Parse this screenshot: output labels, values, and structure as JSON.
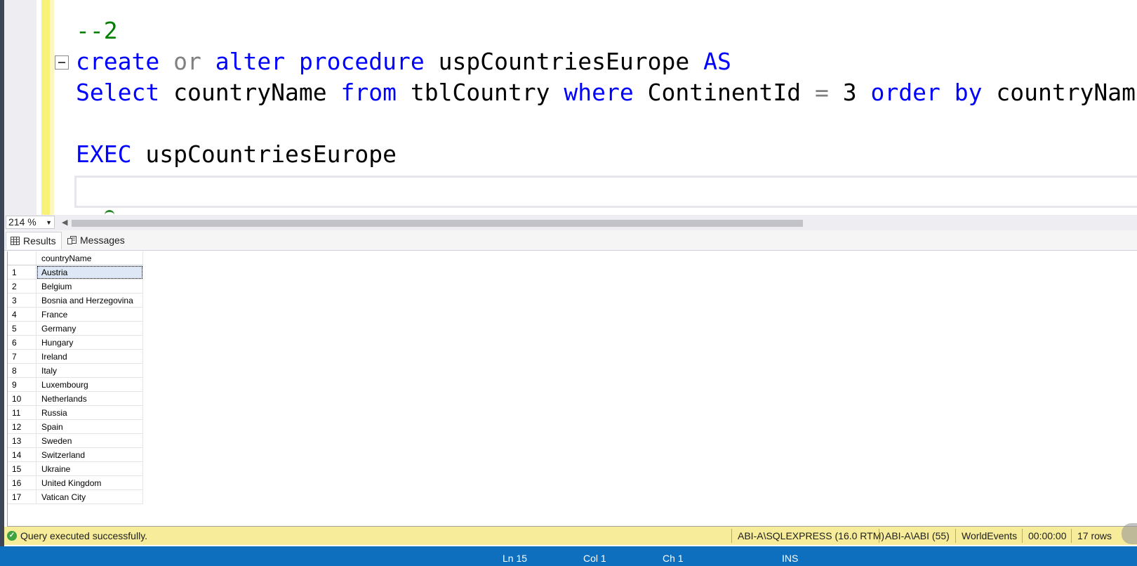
{
  "editor": {
    "lines": [
      {
        "tokens": [
          {
            "t": "--2",
            "c": "cmt"
          }
        ]
      },
      {
        "tokens": [
          {
            "t": "create",
            "c": "kw"
          },
          {
            "t": " ",
            "c": "id"
          },
          {
            "t": "or",
            "c": "gray"
          },
          {
            "t": " ",
            "c": "id"
          },
          {
            "t": "alter",
            "c": "kw"
          },
          {
            "t": " ",
            "c": "id"
          },
          {
            "t": "procedure",
            "c": "kw"
          },
          {
            "t": " uspCountriesEurope ",
            "c": "id"
          },
          {
            "t": "AS",
            "c": "kw"
          }
        ]
      },
      {
        "tokens": [
          {
            "t": "Select",
            "c": "kw"
          },
          {
            "t": " countryName ",
            "c": "id"
          },
          {
            "t": "from",
            "c": "kw"
          },
          {
            "t": " tblCountry ",
            "c": "id"
          },
          {
            "t": "where",
            "c": "kw"
          },
          {
            "t": " ContinentId ",
            "c": "id"
          },
          {
            "t": "=",
            "c": "gray"
          },
          {
            "t": " 3 ",
            "c": "id"
          },
          {
            "t": "order",
            "c": "kw"
          },
          {
            "t": " ",
            "c": "id"
          },
          {
            "t": "by",
            "c": "kw"
          },
          {
            "t": " countryName",
            "c": "id"
          }
        ]
      },
      {
        "tokens": []
      },
      {
        "tokens": [
          {
            "t": "EXEC",
            "c": "kw"
          },
          {
            "t": " uspCountriesEurope",
            "c": "id"
          }
        ]
      }
    ]
  },
  "zoom": {
    "value": "214 %"
  },
  "tabs": {
    "results": "Results",
    "messages": "Messages"
  },
  "grid": {
    "column": "countryName",
    "rows": [
      {
        "n": "1",
        "v": "Austria"
      },
      {
        "n": "2",
        "v": "Belgium"
      },
      {
        "n": "3",
        "v": "Bosnia and Herzegovina"
      },
      {
        "n": "4",
        "v": "France"
      },
      {
        "n": "5",
        "v": "Germany"
      },
      {
        "n": "6",
        "v": "Hungary"
      },
      {
        "n": "7",
        "v": "Ireland"
      },
      {
        "n": "8",
        "v": "Italy"
      },
      {
        "n": "9",
        "v": "Luxembourg"
      },
      {
        "n": "10",
        "v": "Netherlands"
      },
      {
        "n": "11",
        "v": "Russia"
      },
      {
        "n": "12",
        "v": "Spain"
      },
      {
        "n": "13",
        "v": "Sweden"
      },
      {
        "n": "14",
        "v": "Switzerland"
      },
      {
        "n": "15",
        "v": "Ukraine"
      },
      {
        "n": "16",
        "v": "United Kingdom"
      },
      {
        "n": "17",
        "v": "Vatican City"
      }
    ]
  },
  "status": {
    "message": "Query executed successfully.",
    "server": "ABI-A\\SQLEXPRESS (16.0 RTM)",
    "user": "ABI-A\\ABI (55)",
    "database": "WorldEvents",
    "time": "00:00:00",
    "rows": "17 rows"
  },
  "editor_status": {
    "ln": "Ln 15",
    "col": "Col 1",
    "ch": "Ch 1",
    "mode": "INS"
  },
  "colors": {
    "keyword": "#0000ff",
    "comment": "#008000",
    "status_bg": "#f6ec9a",
    "accent": "#0e6fbf"
  }
}
